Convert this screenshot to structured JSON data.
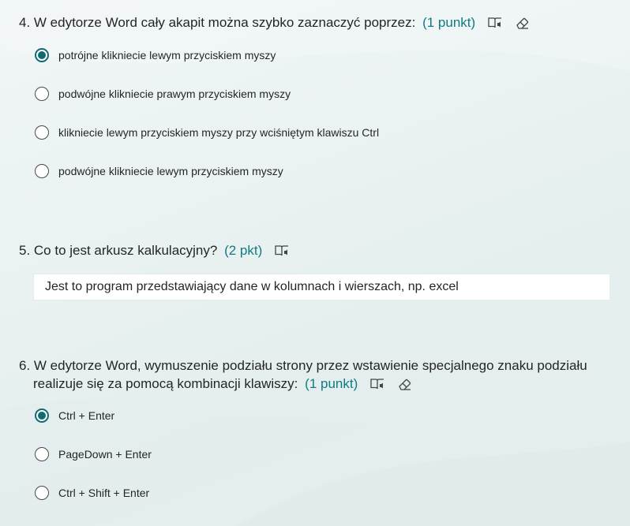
{
  "q4": {
    "title": "4. W edytorze Word cały akapit można szybko zaznaczyć poprzez:",
    "points": "(1 punkt)",
    "options": [
      {
        "label": "potrójne klikniecie lewym przyciskiem myszy",
        "selected": true
      },
      {
        "label": "podwójne klikniecie prawym przyciskiem myszy",
        "selected": false
      },
      {
        "label": "klikniecie lewym przyciskiem myszy przy wciśniętym klawiszu Ctrl",
        "selected": false
      },
      {
        "label": "podwójne klikniecie lewym przyciskiem myszy",
        "selected": false
      }
    ]
  },
  "q5": {
    "title": "5. Co to jest arkusz kalkulacyjny?",
    "points": "(2 pkt)",
    "answer": "Jest to program przedstawiający dane w kolumnach i wierszach, np. excel"
  },
  "q6": {
    "title_line1": "6. W edytorze Word, wymuszenie podziału strony przez wstawienie specjalnego znaku podziału",
    "title_line2": "realizuje się za pomocą kombinacji klawiszy:",
    "points": "(1 punkt)",
    "options": [
      {
        "label": "Ctrl + Enter",
        "selected": true
      },
      {
        "label": "PageDown + Enter",
        "selected": false
      },
      {
        "label": "Ctrl + Shift + Enter",
        "selected": false
      }
    ]
  },
  "colors": {
    "accent": "#0f7a82",
    "radio_selected": "#0f6b72",
    "text": "#252525"
  },
  "icons": [
    "immersive-reader-icon",
    "eraser-icon"
  ]
}
